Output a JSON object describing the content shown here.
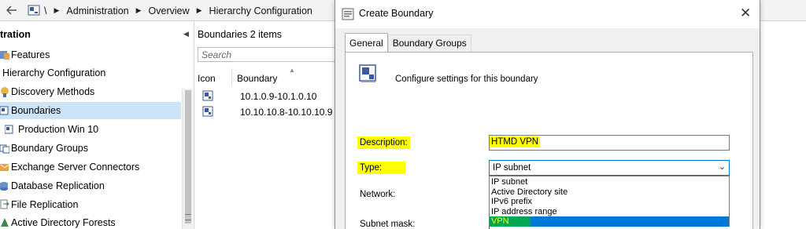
{
  "navbar": {
    "back_icon": "back-arrow-icon",
    "console_icon": "console-icon",
    "root": "\\",
    "crumbs": [
      "Administration",
      "Overview",
      "Hierarchy Configuration"
    ]
  },
  "tree": {
    "header": "tration",
    "items": [
      {
        "label": "Features",
        "icon": "features-icon"
      },
      {
        "label": "Hierarchy Configuration",
        "icon": ""
      },
      {
        "label": "Discovery Methods",
        "icon": "discovery-icon"
      },
      {
        "label": "Boundaries",
        "icon": "boundaries-icon"
      },
      {
        "label": "Production Win 10",
        "icon": "boundary-icon"
      },
      {
        "label": "Boundary Groups",
        "icon": "boundary-groups-icon"
      },
      {
        "label": "Exchange Server Connectors",
        "icon": "exchange-icon"
      },
      {
        "label": "Database Replication",
        "icon": "database-icon"
      },
      {
        "label": "File Replication",
        "icon": "file-replication-icon"
      },
      {
        "label": "Active Directory Forests",
        "icon": "ad-forest-icon"
      }
    ]
  },
  "list": {
    "title": "Boundaries 2 items",
    "search_placeholder": "Search",
    "columns": [
      "Icon",
      "Boundary"
    ],
    "rows": [
      {
        "boundary": "10.1.0.9-10.1.0.10"
      },
      {
        "boundary": "10.10.10.8-10.10.10.9"
      }
    ]
  },
  "dialog": {
    "title": "Create Boundary",
    "tabs": [
      "General",
      "Boundary Groups"
    ],
    "heading": "Configure settings for this boundary",
    "labels": {
      "description": "Description:",
      "type": "Type:",
      "network": "Network:",
      "subnet_mask": "Subnet mask:"
    },
    "description_value": "HTMD VPN",
    "type_value": "IP subnet",
    "type_options": [
      "IP subnet",
      "Active Directory site",
      "IPv6 prefix",
      "IP address range",
      "VPN"
    ],
    "selected_option": "VPN"
  },
  "colors": {
    "highlight": "#ffff00",
    "selection_blue": "#0078d7",
    "green_marker": "#00a651",
    "tree_selected": "#cce4f7"
  }
}
